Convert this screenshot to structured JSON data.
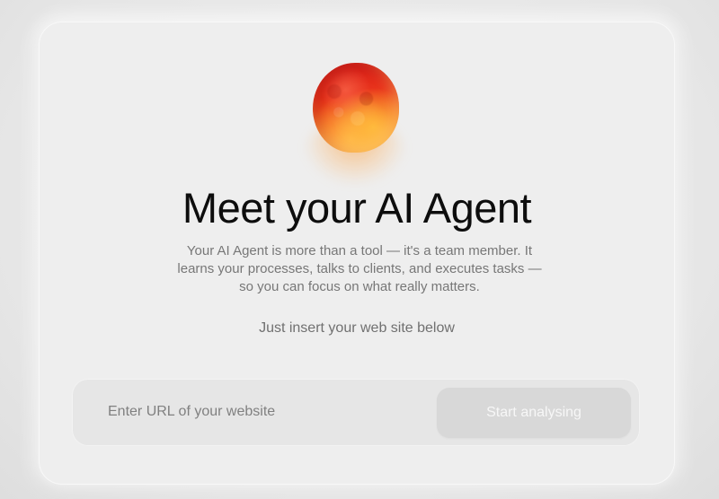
{
  "hero": {
    "title": "Meet your AI Agent",
    "description": "Your AI Agent is more than a tool — it's a team member. It learns your processes, talks to clients, and executes tasks — so you can focus on what really matters.",
    "hint": "Just insert your web site below"
  },
  "form": {
    "url_placeholder": "Enter URL of your website",
    "url_value": "",
    "submit_label": "Start analysing"
  },
  "colors": {
    "orb_primary": "#e8331c",
    "orb_secondary": "#ffa43a",
    "button_disabled_bg": "#d8d8d8"
  },
  "icons": {
    "orb": "ai-agent-orb-icon"
  }
}
